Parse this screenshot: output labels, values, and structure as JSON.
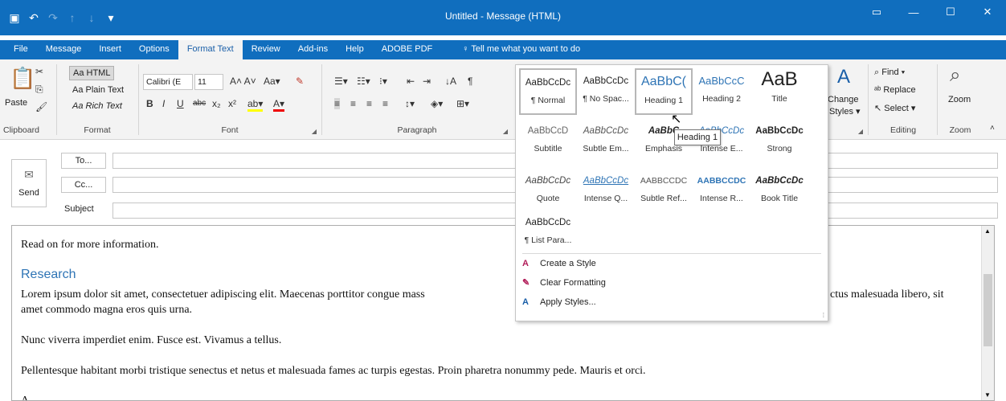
{
  "window": {
    "title": "Untitled  -  Message (HTML)",
    "accent": "#106ebe"
  },
  "qat": {
    "save": "save-icon",
    "undo": "undo-icon",
    "redo": "redo-icon",
    "up": "↑",
    "down": "↓",
    "customize": "▾"
  },
  "wincontrols": {
    "restore": "▭",
    "minimize": "—",
    "maximize": "☐",
    "close": "✕"
  },
  "tabs": [
    "File",
    "Message",
    "Insert",
    "Options",
    "Format Text",
    "Review",
    "Add-ins",
    "Help",
    "ADOBE PDF"
  ],
  "active_tab": "Format Text",
  "tell_me": "Tell me what you want to do",
  "ribbon": {
    "clipboard": {
      "label": "Clipboard",
      "paste": "Paste"
    },
    "format": {
      "label": "Format",
      "html": "Aa HTML",
      "plain": "Aa Plain Text",
      "rich": "Aa Rich Text"
    },
    "font": {
      "label": "Font",
      "family": "Calibri (E",
      "size": "11"
    },
    "paragraph": {
      "label": "Paragraph"
    },
    "change_styles": {
      "label": "Change Styles",
      "line1": "Change",
      "line2": "Styles ▾"
    },
    "editing": {
      "label": "Editing",
      "find": "Find",
      "replace": "Replace",
      "select": "Select"
    },
    "zoom": {
      "label": "Zoom",
      "button": "Zoom"
    }
  },
  "compose": {
    "send": "Send",
    "to": "To...",
    "cc": "Cc...",
    "subject": "Subject"
  },
  "body": {
    "line1": "Read on for more information.",
    "heading": "Research",
    "para1": "Lorem ipsum dolor sit amet, consectetuer adipiscing elit. Maecenas porttitor congue mass",
    "para1_tail": "ctus malesuada libero, sit",
    "para1_line2": "amet commodo magna eros quis urna.",
    "para2": "Nunc viverra imperdiet enim. Fusce est. Vivamus a tellus.",
    "para3": "Pellentesque habitant morbi tristique senectus et netus et malesuada fames ac turpis egestas. Proin pharetra nonummy pede. Mauris et orci.",
    "para4": "A"
  },
  "styles": [
    {
      "preview": "AaBbCcDc",
      "name": "¶ Normal",
      "selected": true
    },
    {
      "preview": "AaBbCcDc",
      "name": "¶ No Spac..."
    },
    {
      "preview": "AaBbC(",
      "name": "Heading 1",
      "selected": true
    },
    {
      "preview": "AaBbCcC",
      "name": "Heading 2"
    },
    {
      "preview": "AaB",
      "name": "Title"
    },
    {
      "preview": "AaBbCcD",
      "name": "Subtitle"
    },
    {
      "preview": "AaBbCcDc",
      "name": "Subtle Em..."
    },
    {
      "preview": "AaBbC",
      "name": "Emphasis"
    },
    {
      "preview": "AaBbCcDc",
      "name": "Intense E..."
    },
    {
      "preview": "AaBbCcDc",
      "name": "Strong"
    },
    {
      "preview": "AaBbCcDc",
      "name": "Quote"
    },
    {
      "preview": "AaBbCcDc",
      "name": "Intense Q..."
    },
    {
      "preview": "AABBCCDC",
      "name": "Subtle Ref..."
    },
    {
      "preview": "AABBCCDC",
      "name": "Intense R..."
    },
    {
      "preview": "AaBbCcDc",
      "name": "Book Title"
    },
    {
      "preview": "AaBbCcDc",
      "name": "¶ List Para..."
    }
  ],
  "gallery_commands": [
    {
      "label": "Create a Style",
      "icon": "create-style-icon"
    },
    {
      "label": "Clear Formatting",
      "icon": "clear-formatting-icon"
    },
    {
      "label": "Apply Styles...",
      "icon": "apply-styles-icon"
    }
  ],
  "tooltip": "Heading 1"
}
